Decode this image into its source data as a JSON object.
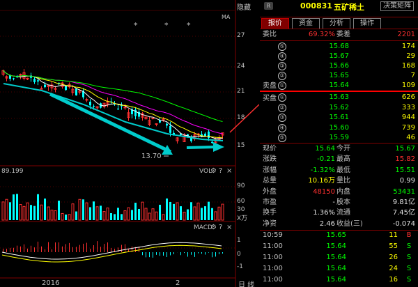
{
  "chart": {
    "hide_label": "隐藏",
    "ma_label": "MA",
    "price_axis": [
      "27",
      "24",
      "21",
      "18",
      "15"
    ],
    "low_marker": "13.70",
    "left_value": "89.199",
    "vol_label": "VOL",
    "vol_axis": [
      "90",
      "60",
      "30"
    ],
    "vol_unit": "X万",
    "macd_label": "MACD",
    "macd_axis": [
      "1",
      "0",
      "-1"
    ],
    "year_label": "2016",
    "month_label": "2",
    "period_label": "日 线",
    "star_marks": [
      "*",
      "*",
      "*"
    ]
  },
  "header": {
    "badge": "R",
    "code": "000831",
    "name": "五矿稀土",
    "decision_button": "决策矩阵"
  },
  "tabs": [
    "报价",
    "资金",
    "分析",
    "操作"
  ],
  "weibi": {
    "label": "委比",
    "value": "69.32%",
    "label2": "委差",
    "value2": "2201"
  },
  "sell_label": "卖盘",
  "buy_label": "买盘",
  "asks": [
    {
      "n": "⑤",
      "price": "15.68",
      "vol": "174"
    },
    {
      "n": "④",
      "price": "15.67",
      "vol": "29"
    },
    {
      "n": "③",
      "price": "15.66",
      "vol": "168"
    },
    {
      "n": "②",
      "price": "15.65",
      "vol": "7"
    },
    {
      "n": "①",
      "price": "15.64",
      "vol": "109"
    }
  ],
  "bids": [
    {
      "n": "①",
      "price": "15.63",
      "vol": "626"
    },
    {
      "n": "②",
      "price": "15.62",
      "vol": "333"
    },
    {
      "n": "③",
      "price": "15.61",
      "vol": "944"
    },
    {
      "n": "④",
      "price": "15.60",
      "vol": "739"
    },
    {
      "n": "⑤",
      "price": "15.59",
      "vol": "46"
    }
  ],
  "quote": [
    {
      "l1": "现价",
      "v1": "15.64",
      "l2": "今开",
      "v2": "15.67"
    },
    {
      "l1": "涨跌",
      "v1": "-0.21",
      "l2": "最高",
      "v2": "15.82"
    },
    {
      "l1": "涨幅",
      "v1": "-1.32%",
      "l2": "最低",
      "v2": "15.51"
    },
    {
      "l1": "总量",
      "v1": "10.16万",
      "l2": "量比",
      "v2": "0.99"
    },
    {
      "l1": "外盘",
      "v1": "48150",
      "l2": "内盘",
      "v2": "53431"
    },
    {
      "l1": "市盈",
      "v1": "-",
      "l2": "股本",
      "v2": "9.81亿"
    },
    {
      "l1": "换手",
      "v1": "1.36%",
      "l2": "流通",
      "v2": "7.45亿"
    },
    {
      "l1": "净资",
      "v1": "2.46",
      "l2": "收益(三)",
      "v2": "-0.074"
    }
  ],
  "ticks": [
    {
      "time": "10:59",
      "price": "15.65",
      "vol": "11",
      "dir": "B"
    },
    {
      "time": "11:00",
      "price": "15.64",
      "vol": "55",
      "dir": "S"
    },
    {
      "time": "11:00",
      "price": "15.64",
      "vol": "26",
      "dir": "S"
    },
    {
      "time": "11:00",
      "price": "15.64",
      "vol": "24",
      "dir": "S"
    },
    {
      "time": "11:00",
      "price": "15.64",
      "vol": "16",
      "dir": "S"
    }
  ],
  "colors": {
    "up": "#ff3030",
    "down": "#00ffff",
    "ma5": "#ffffff",
    "ma10": "#ffff00",
    "ma20": "#ff00ff",
    "ma60": "#00ff00",
    "annotation": "#ff3030",
    "arrow": "#00cccc"
  }
}
